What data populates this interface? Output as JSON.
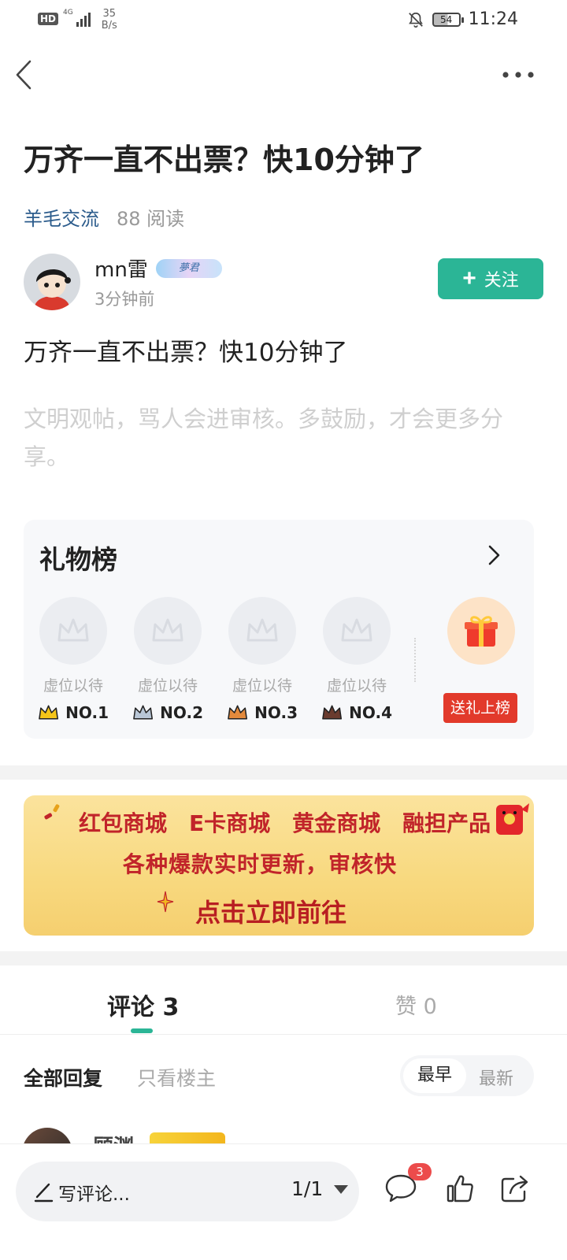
{
  "status_bar": {
    "network_hd": "HD",
    "network_gen": "4G",
    "speed_value": "35",
    "speed_unit": "B/s",
    "battery": "54",
    "time": "11:24"
  },
  "nav": {
    "back_icon": "chevron-left-icon",
    "more_icon": "more-horizontal-icon"
  },
  "post": {
    "title": "万齐一直不出票？快10分钟了",
    "category": "羊毛交流",
    "reads": "88 阅读",
    "author_name": "mn雷",
    "author_badge": "夢君",
    "posted_time": "3分钟前",
    "follow_label": "关注",
    "body": "万齐一直不出票？快10分钟了",
    "notice": "文明观帖，骂人会进审核。多鼓励，才会更多分享。"
  },
  "gift_board": {
    "title": "礼物榜",
    "slots": [
      {
        "label": "虚位以待",
        "rank": "NO.1",
        "crown_color": "#f5c518"
      },
      {
        "label": "虚位以待",
        "rank": "NO.2",
        "crown_color": "#b8c6d6"
      },
      {
        "label": "虚位以待",
        "rank": "NO.3",
        "crown_color": "#e38a3c"
      },
      {
        "label": "虚位以待",
        "rank": "NO.4",
        "crown_color": "#6a3b2e"
      }
    ],
    "send_label": "送礼上榜"
  },
  "banner": {
    "items": [
      "红包商城",
      "E卡商城",
      "黄金商城",
      "融担产品"
    ],
    "subtitle": "各种爆款实时更新，审核快",
    "cta": "点击立即前往"
  },
  "tabs": {
    "comments": "评论 3",
    "likes": "赞 0"
  },
  "filters": {
    "all": "全部回复",
    "owner_only": "只看楼主",
    "earliest": "最早",
    "latest": "最新"
  },
  "peek_comment": {
    "name": "顾渊"
  },
  "bottom_bar": {
    "placeholder": "写评论...",
    "page": "1/1",
    "comment_count": "3"
  },
  "colors": {
    "accent": "#2bb596",
    "category": "#2c5c8c",
    "red": "#e23a2b"
  }
}
